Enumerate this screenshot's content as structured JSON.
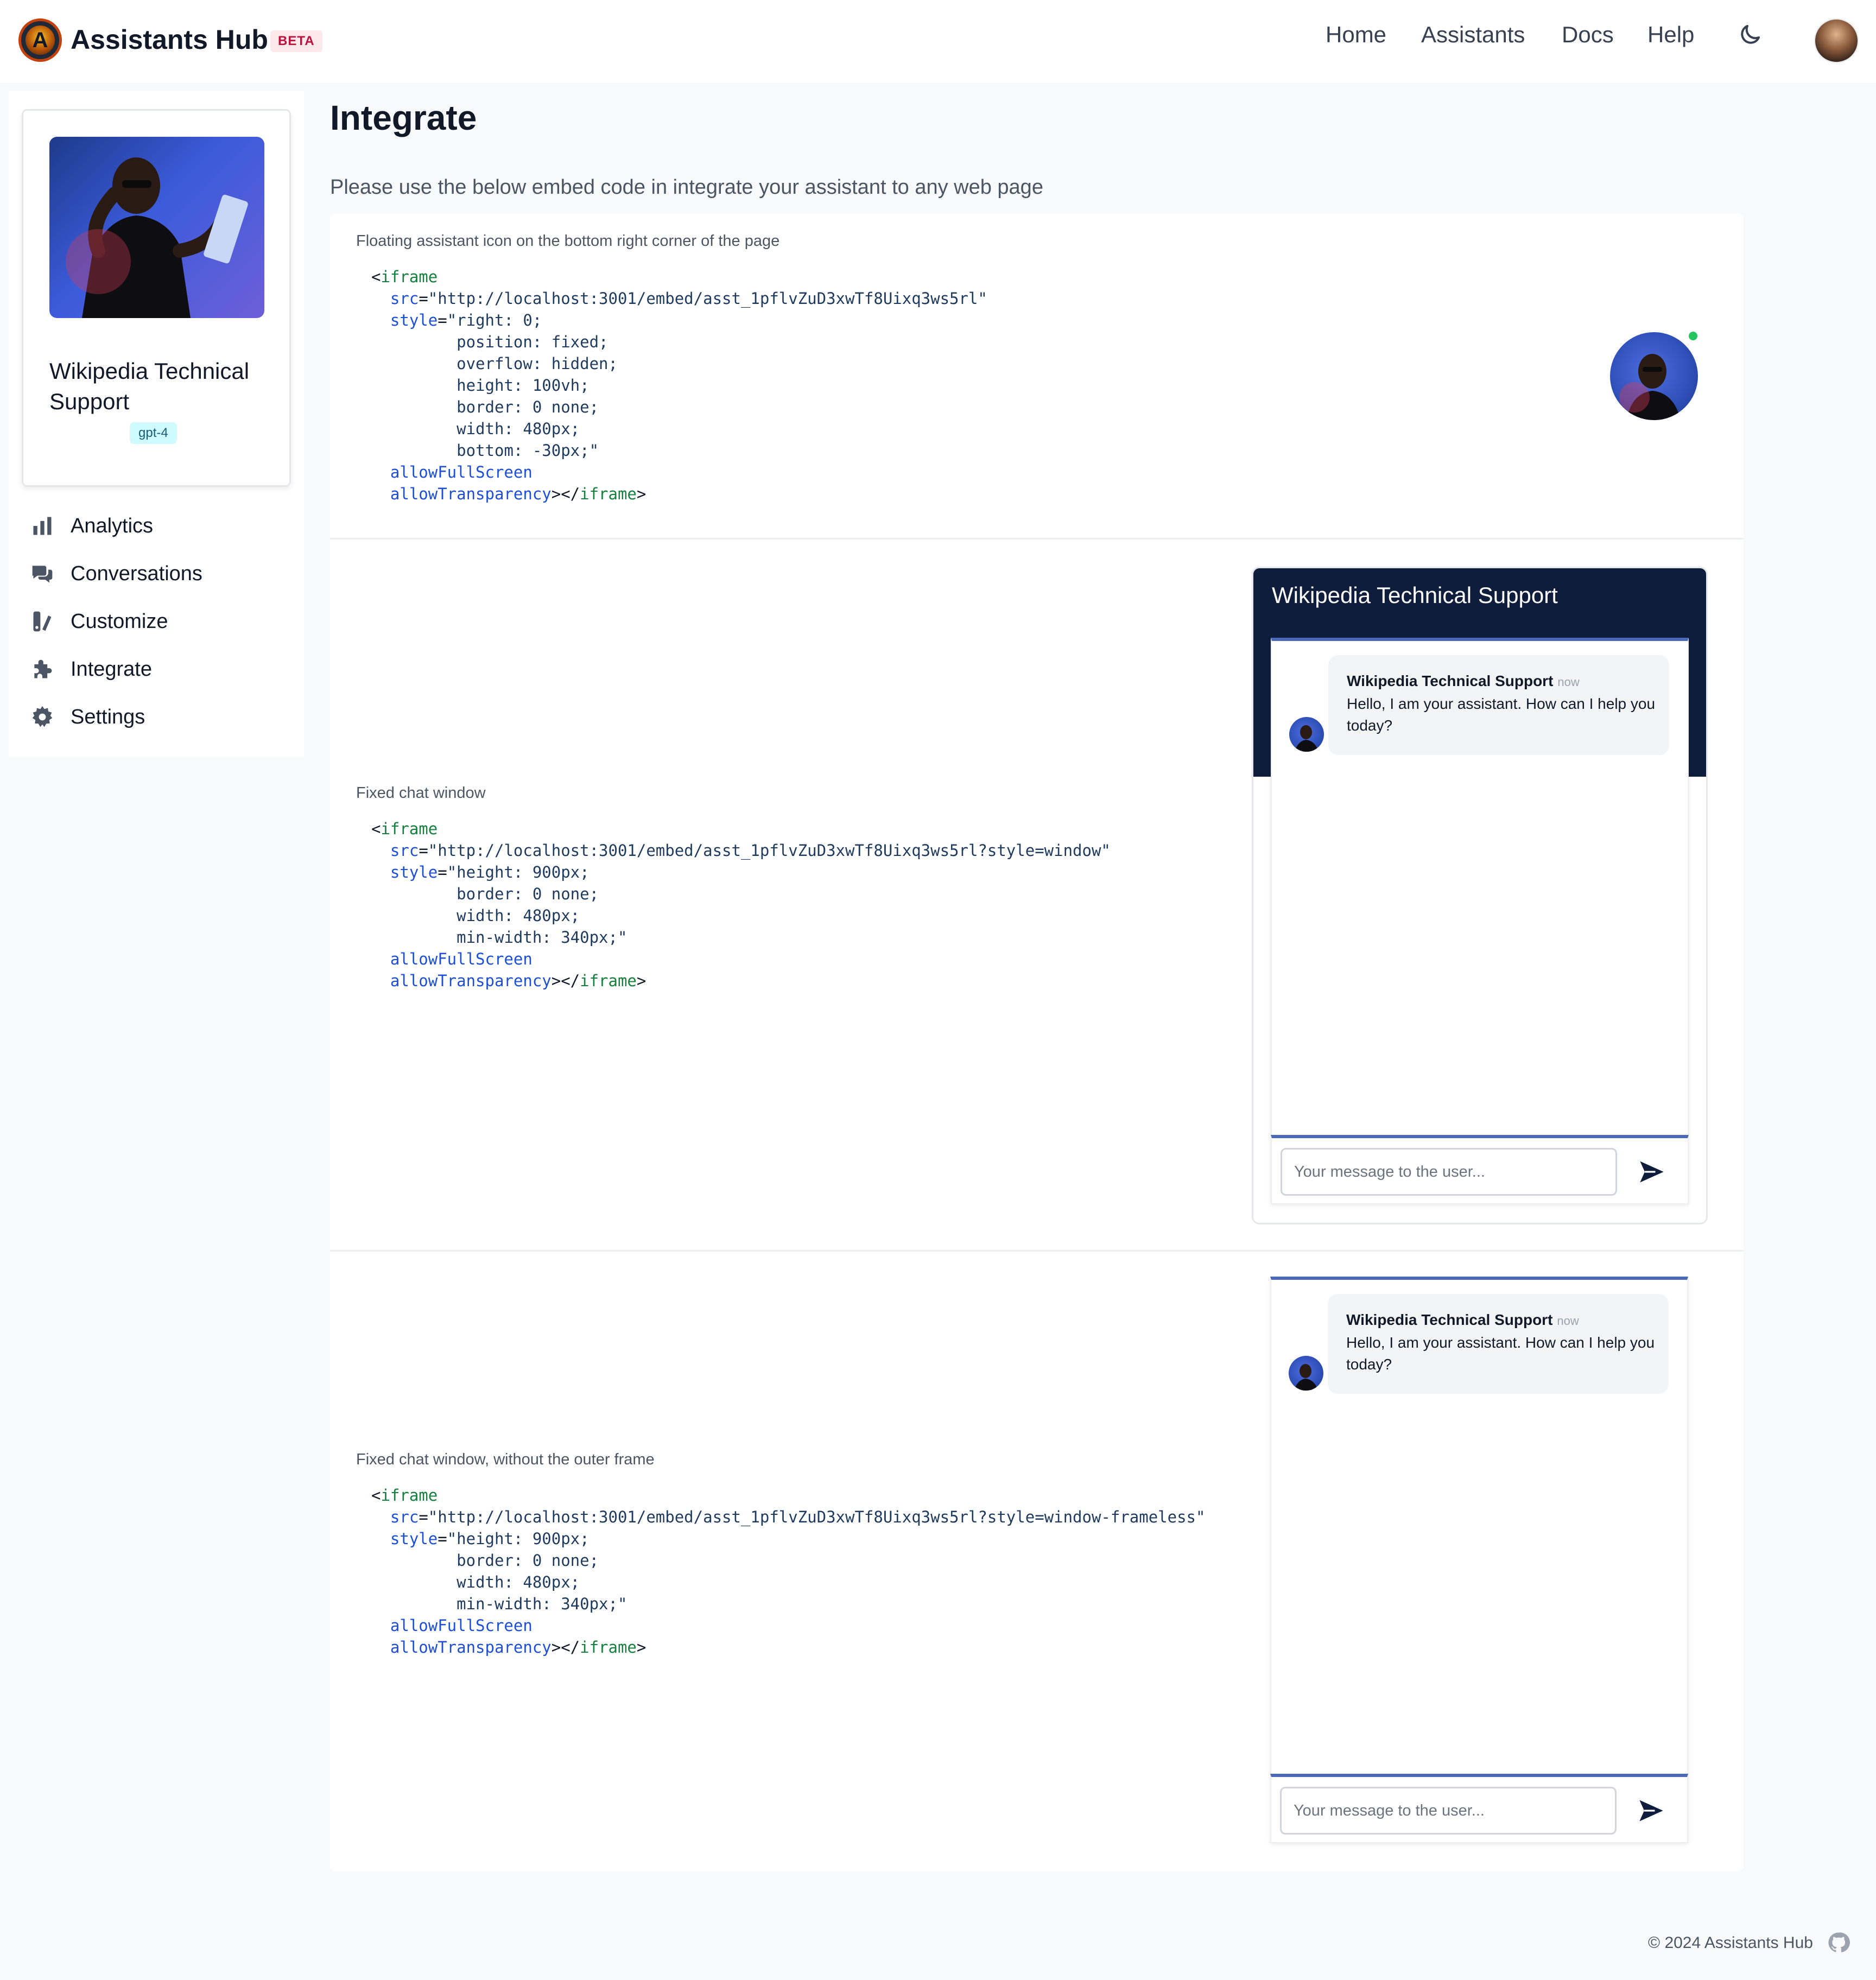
{
  "app": {
    "brand": "Assistants Hub",
    "beta_badge": "BETA"
  },
  "nav": {
    "items": [
      {
        "label": "Home"
      },
      {
        "label": "Assistants"
      },
      {
        "label": "Docs"
      },
      {
        "label": "Help"
      }
    ],
    "theme_icon": "moon-icon"
  },
  "sidebar": {
    "assistant": {
      "name": "Wikipedia Technical Support",
      "model": "gpt-4"
    },
    "items": [
      {
        "label": "Analytics",
        "icon": "bar-chart-icon"
      },
      {
        "label": "Conversations",
        "icon": "chat-bubbles-icon"
      },
      {
        "label": "Customize",
        "icon": "customize-icon"
      },
      {
        "label": "Integrate",
        "icon": "puzzle-icon"
      },
      {
        "label": "Settings",
        "icon": "gear-icon"
      }
    ]
  },
  "main": {
    "title": "Integrate",
    "description": "Please use the below embed code in integrate your assistant to any web page",
    "sections": [
      {
        "label": "Floating assistant icon on the bottom right corner of the page",
        "code": {
          "open_tag": "iframe",
          "src": "\"http://localhost:3001/embed/asst_1pflvZuD3xwTf8Uixq3ws5rl\"",
          "style_lines": [
            "\"right: 0;",
            "position: fixed;",
            "overflow: hidden;",
            "height: 100vh;",
            "border: 0 none;",
            "width: 480px;",
            "bottom: -30px;\""
          ],
          "attr1": "allowFullScreen",
          "attr2": "allowTransparency",
          "close_tag": "iframe"
        }
      },
      {
        "label": "Fixed chat window",
        "code": {
          "open_tag": "iframe",
          "src": "\"http://localhost:3001/embed/asst_1pflvZuD3xwTf8Uixq3ws5rl?style=window\"",
          "style_lines": [
            "\"height: 900px;",
            "border: 0 none;",
            "width: 480px;",
            "min-width: 340px;\""
          ],
          "attr1": "allowFullScreen",
          "attr2": "allowTransparency",
          "close_tag": "iframe"
        }
      },
      {
        "label": "Fixed chat window, without the outer frame",
        "code": {
          "open_tag": "iframe",
          "src": "\"http://localhost:3001/embed/asst_1pflvZuD3xwTf8Uixq3ws5rl?style=window-frameless\"",
          "style_lines": [
            "\"height: 900px;",
            "border: 0 none;",
            "width: 480px;",
            "min-width: 340px;\""
          ],
          "attr1": "allowFullScreen",
          "attr2": "allowTransparency",
          "close_tag": "iframe"
        }
      }
    ]
  },
  "chat_preview": {
    "title": "Wikipedia Technical Support",
    "sender": "Wikipedia Technical Support",
    "time": "now",
    "message": "Hello, I am your assistant. How can I help you today?",
    "input_placeholder": "Your message to the user..."
  },
  "footer": {
    "copyright": "© 2024 Assistants Hub"
  },
  "colors": {
    "chat_header": "#0f1d3d",
    "accent_border": "#4a6ab8",
    "online": "#22c55e",
    "beta": "#be123c"
  }
}
